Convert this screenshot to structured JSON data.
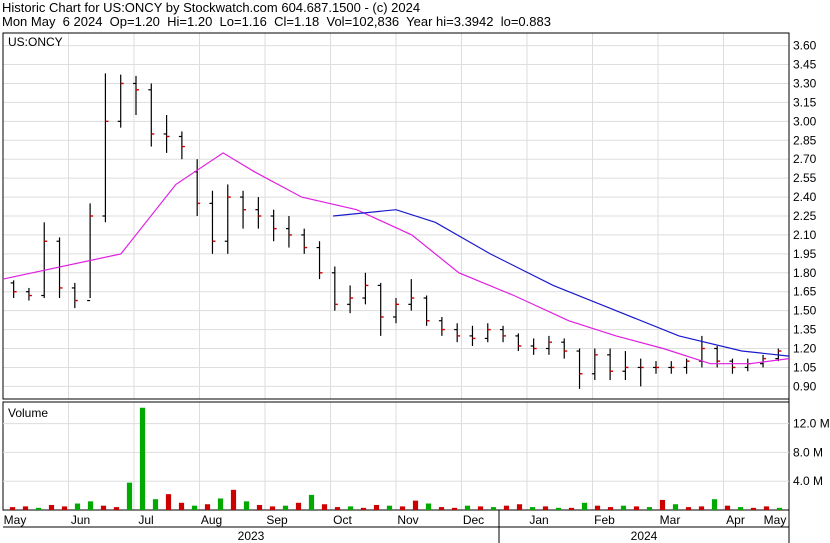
{
  "header": {
    "line1": "Historic Chart for US:ONCY by Stockwatch.com 604.687.1500 - (c) 2024",
    "line2": "Mon May  6 2024  Op=1.20  Hi=1.20  Lo=1.16  Cl=1.18  Vol=102,836  Year hi=3.3942  lo=0.883"
  },
  "colors": {
    "price_bar": "#000000",
    "close_tick": "#cc0000",
    "ma_short": "#e020e0",
    "ma_long": "#1a1acc",
    "volume_up": "#00aa00",
    "volume_down": "#cc0000",
    "grid": "#dddddd",
    "frame": "#000000"
  },
  "chart_data": [
    {
      "type": "line",
      "title": "US:ONCY",
      "ylim": [
        0.8,
        3.7
      ],
      "y_ticks": [
        "3.60",
        "3.45",
        "3.30",
        "3.15",
        "3.00",
        "2.85",
        "2.70",
        "2.55",
        "2.40",
        "2.25",
        "2.10",
        "1.95",
        "1.80",
        "1.65",
        "1.50",
        "1.35",
        "1.20",
        "1.05",
        "0.90"
      ],
      "x_months": [
        "May",
        "Jun",
        "Jul",
        "Aug",
        "Sep",
        "Oct",
        "Nov",
        "Dec",
        "Jan",
        "Feb",
        "Mar",
        "Apr",
        "May"
      ],
      "x_years": [
        "2023",
        "2024"
      ],
      "price_bars": {
        "x_unit": "week",
        "ohlc_weekly": [
          [
            1.72,
            1.74,
            1.6,
            1.65
          ],
          [
            1.65,
            1.68,
            1.58,
            1.62
          ],
          [
            1.62,
            2.2,
            1.6,
            2.05
          ],
          [
            2.05,
            2.08,
            1.6,
            1.68
          ],
          [
            1.68,
            1.72,
            1.52,
            1.58
          ],
          [
            1.58,
            2.35,
            1.6,
            2.25
          ],
          [
            2.25,
            3.38,
            2.2,
            3.0
          ],
          [
            3.0,
            3.37,
            2.95,
            3.3
          ],
          [
            3.3,
            3.36,
            3.05,
            3.25
          ],
          [
            3.25,
            3.3,
            2.8,
            2.9
          ],
          [
            2.9,
            3.05,
            2.75,
            2.88
          ],
          [
            2.88,
            2.92,
            2.7,
            2.8
          ],
          [
            2.6,
            2.7,
            2.25,
            2.35
          ],
          [
            2.35,
            2.45,
            1.95,
            2.05
          ],
          [
            2.05,
            2.5,
            1.95,
            2.4
          ],
          [
            2.4,
            2.45,
            2.15,
            2.3
          ],
          [
            2.3,
            2.4,
            2.15,
            2.25
          ],
          [
            2.25,
            2.3,
            2.05,
            2.15
          ],
          [
            2.15,
            2.25,
            2.0,
            2.1
          ],
          [
            2.1,
            2.15,
            1.95,
            2.0
          ],
          [
            2.0,
            2.05,
            1.75,
            1.8
          ],
          [
            1.8,
            1.85,
            1.5,
            1.55
          ],
          [
            1.55,
            1.7,
            1.48,
            1.6
          ],
          [
            1.6,
            1.8,
            1.55,
            1.7
          ],
          [
            1.7,
            1.72,
            1.3,
            1.45
          ],
          [
            1.45,
            1.6,
            1.4,
            1.55
          ],
          [
            1.55,
            1.75,
            1.5,
            1.6
          ],
          [
            1.6,
            1.62,
            1.38,
            1.42
          ],
          [
            1.42,
            1.45,
            1.3,
            1.35
          ],
          [
            1.35,
            1.4,
            1.25,
            1.3
          ],
          [
            1.3,
            1.38,
            1.22,
            1.28
          ],
          [
            1.28,
            1.4,
            1.25,
            1.35
          ],
          [
            1.35,
            1.38,
            1.25,
            1.3
          ],
          [
            1.3,
            1.32,
            1.18,
            1.22
          ],
          [
            1.22,
            1.28,
            1.15,
            1.2
          ],
          [
            1.2,
            1.3,
            1.15,
            1.25
          ],
          [
            1.25,
            1.28,
            1.12,
            1.18
          ],
          [
            1.18,
            1.2,
            0.88,
            1.0
          ],
          [
            1.0,
            1.2,
            0.95,
            1.15
          ],
          [
            1.15,
            1.2,
            0.95,
            1.02
          ],
          [
            1.02,
            1.18,
            0.95,
            1.05
          ],
          [
            1.05,
            1.12,
            0.9,
            1.05
          ],
          [
            1.05,
            1.1,
            1.0,
            1.05
          ],
          [
            1.05,
            1.1,
            1.0,
            1.05
          ],
          [
            1.05,
            1.12,
            1.0,
            1.1
          ],
          [
            1.1,
            1.3,
            1.05,
            1.2
          ],
          [
            1.2,
            1.22,
            1.05,
            1.1
          ],
          [
            1.1,
            1.12,
            1.0,
            1.05
          ],
          [
            1.05,
            1.12,
            1.02,
            1.08
          ],
          [
            1.08,
            1.15,
            1.05,
            1.12
          ],
          [
            1.12,
            1.2,
            1.1,
            1.18
          ]
        ]
      },
      "moving_averages": [
        {
          "color_key": "ma_short",
          "points": [
            [
              0,
              1.75
            ],
            [
              0.15,
              1.95
            ],
            [
              0.22,
              2.5
            ],
            [
              0.28,
              2.75
            ],
            [
              0.32,
              2.6
            ],
            [
              0.38,
              2.4
            ],
            [
              0.45,
              2.3
            ],
            [
              0.52,
              2.1
            ],
            [
              0.58,
              1.8
            ],
            [
              0.65,
              1.62
            ],
            [
              0.72,
              1.42
            ],
            [
              0.78,
              1.3
            ],
            [
              0.84,
              1.2
            ],
            [
              0.9,
              1.08
            ],
            [
              0.95,
              1.08
            ],
            [
              1,
              1.12
            ]
          ]
        },
        {
          "color_key": "ma_long",
          "points": [
            [
              0.42,
              2.25
            ],
            [
              0.5,
              2.3
            ],
            [
              0.55,
              2.2
            ],
            [
              0.62,
              1.95
            ],
            [
              0.7,
              1.7
            ],
            [
              0.78,
              1.5
            ],
            [
              0.86,
              1.3
            ],
            [
              0.94,
              1.18
            ],
            [
              1,
              1.14
            ]
          ]
        }
      ]
    },
    {
      "type": "bar",
      "title": "Volume",
      "ylim": [
        0,
        15
      ],
      "y_ticks": [
        "12.0 M",
        "8.0 M",
        "4.0 M"
      ],
      "values": [
        0.4,
        0.5,
        0.3,
        0.7,
        0.5,
        0.9,
        1.2,
        0.6,
        0.4,
        3.8,
        14.2,
        1.5,
        2.2,
        1.0,
        0.6,
        0.8,
        1.6,
        2.8,
        1.2,
        0.7,
        0.5,
        0.6,
        1.0,
        2.1,
        0.8,
        0.4,
        0.5,
        0.3,
        0.7,
        0.6,
        0.5,
        1.3,
        0.9,
        0.4,
        0.3,
        0.6,
        0.5,
        0.4,
        0.6,
        0.8,
        0.4,
        0.5,
        0.3,
        0.3,
        1.0,
        0.6,
        0.4,
        0.6,
        0.5,
        0.4,
        1.4,
        0.8,
        0.4,
        0.5,
        1.5,
        0.6,
        0.4,
        0.3,
        0.5,
        0.3
      ],
      "colors_up": [
        false,
        false,
        true,
        false,
        false,
        true,
        true,
        false,
        false,
        true,
        true,
        true,
        false,
        false,
        true,
        false,
        true,
        false,
        true,
        false,
        false,
        true,
        false,
        true,
        false,
        false,
        true,
        false,
        false,
        true,
        false,
        false,
        true,
        false,
        false,
        true,
        false,
        true,
        false,
        false,
        true,
        false,
        true,
        false,
        true,
        false,
        false,
        true,
        false,
        true,
        false,
        true,
        false,
        false,
        true,
        false,
        true,
        false,
        false,
        true
      ]
    }
  ]
}
